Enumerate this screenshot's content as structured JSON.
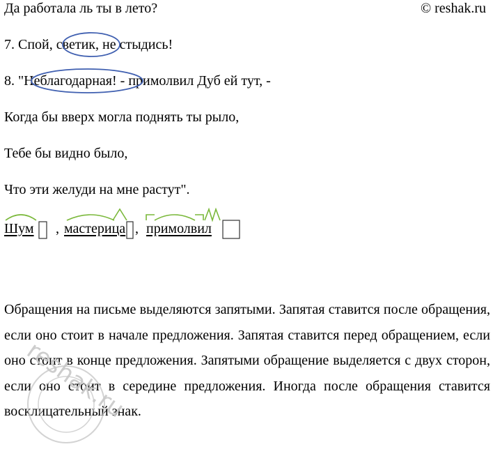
{
  "header": {
    "line_text": "Да работала ль ты в лето?",
    "copyright": "© reshak.ru"
  },
  "lines": [
    {
      "number": "7.",
      "before": "Спой, ",
      "circled": "светик,",
      "after": " не стыдись!"
    },
    {
      "number": "8.",
      "before": "\"",
      "circled": "Неблагодарная!",
      "after": " - примолвил Дуб ей тут, -"
    },
    {
      "text": "Когда бы вверх могла поднять ты рыло,"
    },
    {
      "text": "Тебе бы видно было,"
    },
    {
      "text": "Что эти желуди на мне растут\"."
    }
  ],
  "morphemes": {
    "word1": "Шум",
    "sep1": ",",
    "word2": "мастерица",
    "sep2": ",",
    "word3": "примолвил"
  },
  "paragraph": "Обращения на письме выделяются запятыми. Запятая ставится после обращения, если оно стоит в начале предложения. Запятая ставится перед обращением, если оно стоит в конце предложения. Запятыми обращение выделяется с двух сторон, если оно стоит в середине предложения. Иногда после обращения ставится восклицательный знак.",
  "watermark": {
    "text": "reshak.ru"
  },
  "colors": {
    "circle": "#3f5fb0",
    "morph_mark": "#7ab83a",
    "watermark": "#c8c8c8"
  }
}
